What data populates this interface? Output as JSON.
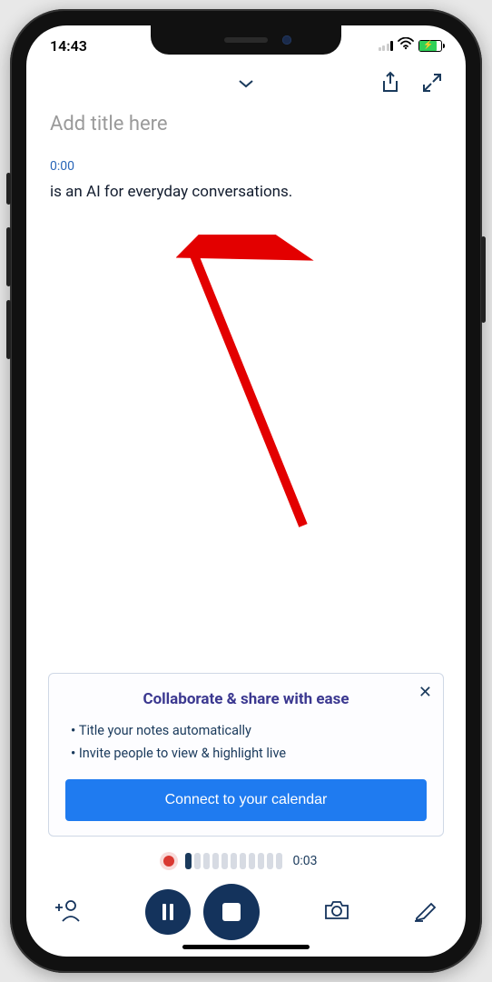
{
  "status": {
    "time": "14:43"
  },
  "header": {
    "title_placeholder": "Add title here"
  },
  "transcript": {
    "timestamp": "0:00",
    "text": "is an AI for everyday conversations."
  },
  "banner": {
    "heading": "Collaborate & share with ease",
    "bullets": [
      "Title your notes automatically",
      "Invite people to view & highlight live"
    ],
    "cta": "Connect to your calendar"
  },
  "player": {
    "elapsed": "0:03"
  }
}
